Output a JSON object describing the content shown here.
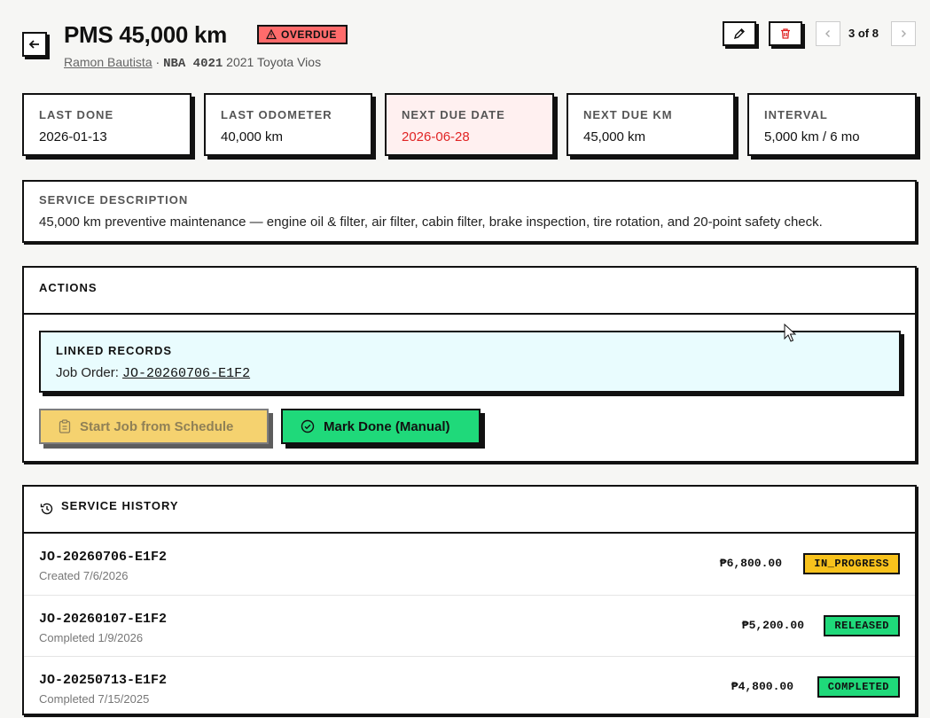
{
  "header": {
    "title": "PMS 45,000 km",
    "status_badge": "OVERDUE",
    "owner": "Ramon Bautista",
    "separator": "·",
    "plate": "NBA 4021",
    "vehicle": "2021 Toyota Vios",
    "pager": "3 of 8"
  },
  "stats": [
    {
      "label": "LAST DONE",
      "value": "2026-01-13"
    },
    {
      "label": "LAST ODOMETER",
      "value": "40,000 km"
    },
    {
      "label": "NEXT DUE DATE",
      "value": "2026-06-28"
    },
    {
      "label": "NEXT DUE KM",
      "value": "45,000 km"
    },
    {
      "label": "INTERVAL",
      "value": "5,000 km / 6 mo"
    }
  ],
  "description": {
    "label": "SERVICE DESCRIPTION",
    "text": "45,000 km preventive maintenance — engine oil & filter, air filter, cabin filter, brake inspection, tire rotation, and 20-point safety check."
  },
  "actions": {
    "title": "ACTIONS",
    "linked_title": "LINKED RECORDS",
    "linked_label": "Job Order:",
    "linked_job": "JO-20260706-E1F2",
    "start_button": "Start Job from Schedule",
    "done_button": "Mark Done (Manual)"
  },
  "history": {
    "title": "SERVICE HISTORY",
    "rows": [
      {
        "id": "JO-20260706-E1F2",
        "date": "Created 7/6/2026",
        "amount": "₱6,800.00",
        "status": "IN_PROGRESS",
        "status_color": "#f8c21c"
      },
      {
        "id": "JO-20260107-E1F2",
        "date": "Completed 1/9/2026",
        "amount": "₱5,200.00",
        "status": "RELEASED",
        "status_color": "#1fd97a"
      },
      {
        "id": "JO-20250713-E1F2",
        "date": "Completed 7/15/2025",
        "amount": "₱4,800.00",
        "status": "COMPLETED",
        "status_color": "#1fd97a"
      }
    ]
  },
  "colors": {
    "overdue": "#ff6b6b",
    "next_due_bg": "#fff0f0",
    "next_due_text": "#e02424",
    "linked_bg": "#e9fcfe",
    "start_btn": "#f5d068",
    "done_btn": "#1fd97a"
  }
}
